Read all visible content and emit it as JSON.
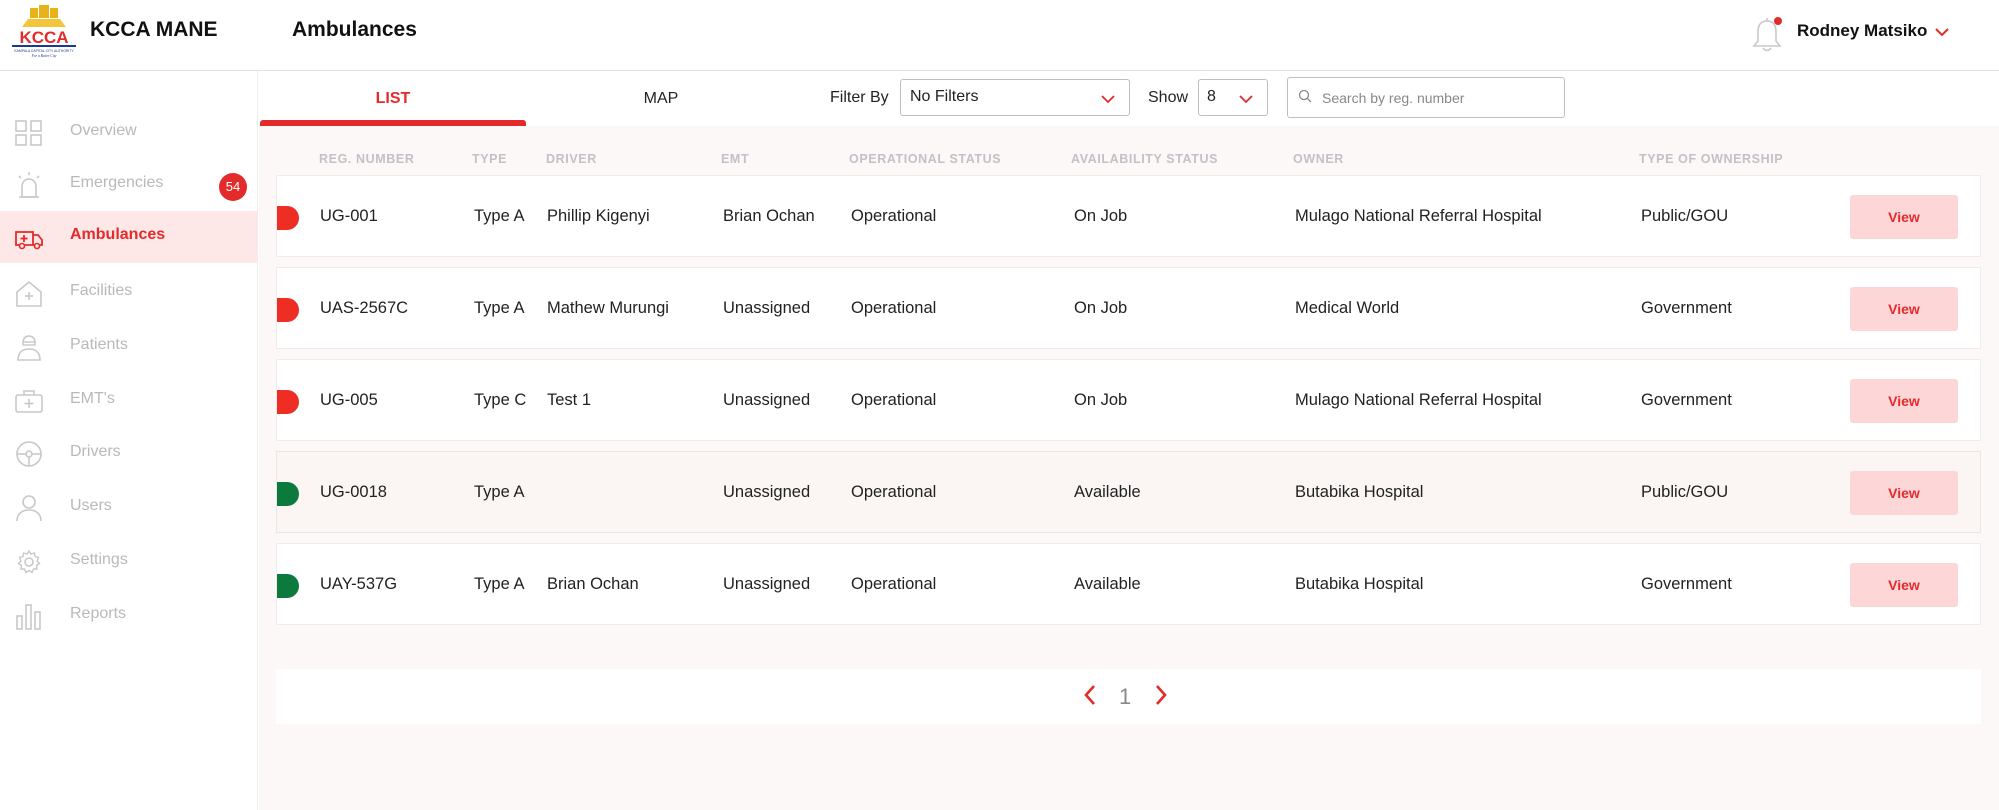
{
  "header": {
    "logo_text": "KCCA",
    "logo_subtext": "KAMPALA CAPITAL CITY AUTHORITY",
    "logo_tagline": "For a Better City",
    "app_name": "KCCA MANE",
    "page_title": "Ambulances",
    "user_name": "Rodney Matsiko",
    "notification_dot": true
  },
  "sidebar": {
    "items": [
      {
        "label": "Overview",
        "icon": "grid-icon"
      },
      {
        "label": "Emergencies",
        "icon": "siren-icon",
        "badge": "54"
      },
      {
        "label": "Ambulances",
        "icon": "ambulance-icon",
        "active": true
      },
      {
        "label": "Facilities",
        "icon": "hospital-icon"
      },
      {
        "label": "Patients",
        "icon": "patient-icon"
      },
      {
        "label": "EMT's",
        "icon": "medical-kit-icon"
      },
      {
        "label": "Drivers",
        "icon": "steering-wheel-icon"
      },
      {
        "label": "Users",
        "icon": "user-icon"
      },
      {
        "label": "Settings",
        "icon": "gear-icon"
      },
      {
        "label": "Reports",
        "icon": "bar-chart-icon"
      }
    ]
  },
  "tabs": [
    {
      "label": "LIST",
      "active": true
    },
    {
      "label": "MAP",
      "active": false
    }
  ],
  "filters": {
    "filter_by_label": "Filter By",
    "filter_value": "No Filters",
    "show_label": "Show",
    "show_value": "8",
    "search_placeholder": "Search by reg. number"
  },
  "table": {
    "columns": [
      "REG. NUMBER",
      "TYPE",
      "DRIVER",
      "EMT",
      "OPERATIONAL STATUS",
      "AVAILABILITY STATUS",
      "OWNER",
      "TYPE OF OWNERSHIP"
    ],
    "view_label": "View",
    "rows": [
      {
        "reg": "UG-001",
        "type": "Type A",
        "driver": "Phillip Kigenyi",
        "emt": "Brian Ochan",
        "op_status": "Operational",
        "availability": "On Job",
        "owner": "Mulago National Referral Hospital",
        "ownership": "Public/GOU",
        "status_color": "#ee2d24"
      },
      {
        "reg": "UAS-2567C",
        "type": "Type A",
        "driver": "Mathew Murungi",
        "emt": "Unassigned",
        "op_status": "Operational",
        "availability": "On Job",
        "owner": "Medical World",
        "ownership": "Government",
        "status_color": "#ee2d24"
      },
      {
        "reg": "UG-005",
        "type": "Type C",
        "driver": "Test 1",
        "emt": "Unassigned",
        "op_status": "Operational",
        "availability": "On Job",
        "owner": "Mulago National Referral Hospital",
        "ownership": "Government",
        "status_color": "#ee2d24"
      },
      {
        "reg": "UG-0018",
        "type": "Type A",
        "driver": "",
        "emt": "Unassigned",
        "op_status": "Operational",
        "availability": "Available",
        "owner": "Butabika Hospital",
        "ownership": "Public/GOU",
        "status_color": "#0d7a3d"
      },
      {
        "reg": "UAY-537G",
        "type": "Type A",
        "driver": "Brian Ochan",
        "emt": "Unassigned",
        "op_status": "Operational",
        "availability": "Available",
        "owner": "Butabika Hospital",
        "ownership": "Government",
        "status_color": "#0d7a3d"
      }
    ]
  },
  "pagination": {
    "current_page": "1"
  },
  "colors": {
    "accent": "#e42b2b",
    "on_job": "#ee2d24",
    "available": "#0d7a3d",
    "view_button_bg": "#fdd7d8"
  }
}
